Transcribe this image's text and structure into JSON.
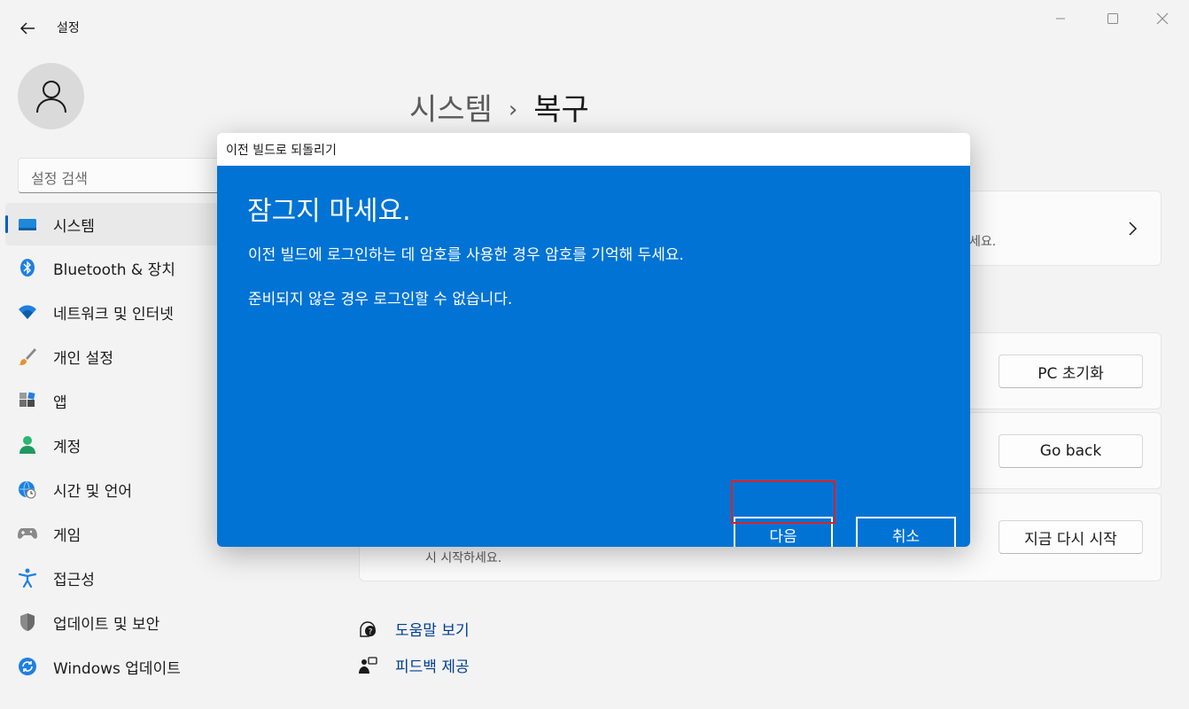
{
  "window": {
    "app_title": "설정"
  },
  "sidebar": {
    "search_placeholder": "설정 검색",
    "items": [
      {
        "label": "시스템",
        "icon": "display-icon",
        "active": true
      },
      {
        "label": "Bluetooth & 장치",
        "icon": "bluetooth-icon"
      },
      {
        "label": "네트워크 및 인터넷",
        "icon": "wifi-icon"
      },
      {
        "label": "개인 설정",
        "icon": "brush-icon"
      },
      {
        "label": "앱",
        "icon": "apps-icon"
      },
      {
        "label": "계정",
        "icon": "account-icon"
      },
      {
        "label": "시간 및 언어",
        "icon": "globe-clock-icon"
      },
      {
        "label": "게임",
        "icon": "gamepad-icon"
      },
      {
        "label": "접근성",
        "icon": "accessibility-icon"
      },
      {
        "label": "업데이트 및 보안",
        "icon": "shield-icon"
      },
      {
        "label": "Windows 업데이트",
        "icon": "sync-icon"
      }
    ]
  },
  "main": {
    "breadcrumb_parent": "시스템",
    "breadcrumb_sep": "›",
    "breadcrumb_current": "복구",
    "card1_partial_text": "세요.",
    "reset_button": "PC 초기화",
    "go_back_button": "Go back",
    "restart_button": "지금 다시 시작",
    "card3_partial_text": "시 시작하세요.",
    "help_link": "도움말 보기",
    "feedback_link": "피드백 제공"
  },
  "dialog": {
    "title": "이전 빌드로 되돌리기",
    "heading": "잠그지 마세요.",
    "paragraph1": "이전 빌드에 로그인하는 데 암호를 사용한 경우 암호를 기억해 두세요.",
    "paragraph2": "준비되지 않은 경우 로그인할 수 없습니다.",
    "next_button": "다음",
    "cancel_button": "취소"
  },
  "colors": {
    "dialog_background": "#0073d4",
    "accent": "#005fb8",
    "highlight_box": "#d8232a"
  }
}
